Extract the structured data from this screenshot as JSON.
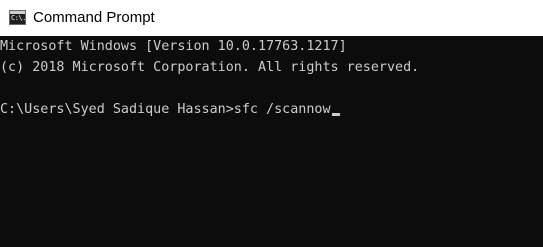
{
  "window": {
    "title": "Command Prompt",
    "icon": "cmd-icon",
    "icon_glyph": "C:\\."
  },
  "console": {
    "lines": [
      "Microsoft Windows [Version 10.0.17763.1217]",
      "(c) 2018 Microsoft Corporation. All rights reserved."
    ],
    "prompt": "C:\\Users\\Syed Sadique Hassan>",
    "command": "sfc /scannow"
  },
  "colors": {
    "background": "#0c0c0c",
    "text": "#cccccc",
    "titlebar": "#ffffff"
  }
}
